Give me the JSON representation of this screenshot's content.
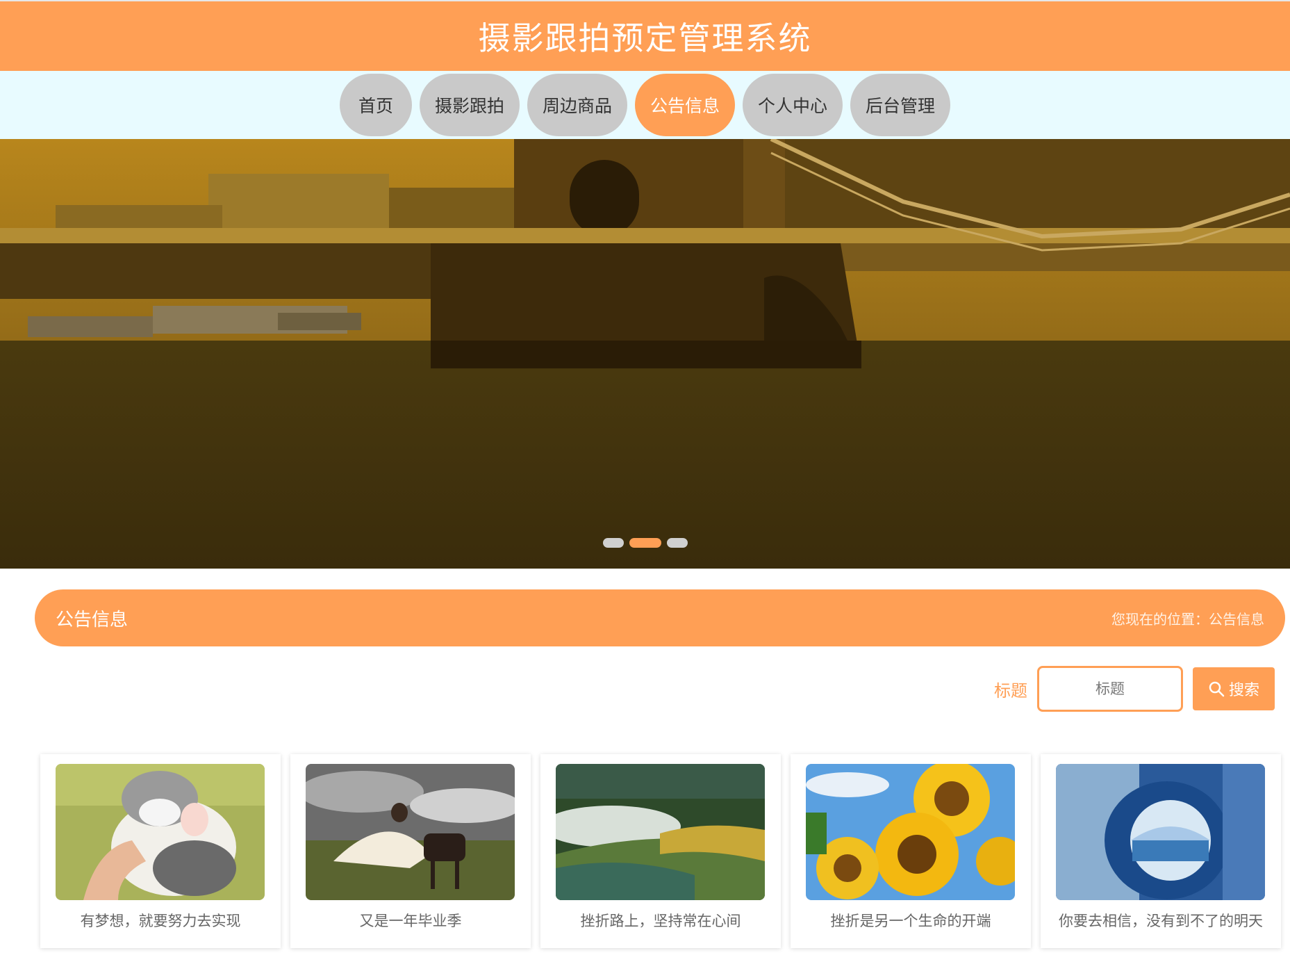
{
  "header": {
    "title": "摄影跟拍预定管理系统"
  },
  "nav": {
    "items": [
      {
        "label": "首页",
        "active": false
      },
      {
        "label": "摄影跟拍",
        "active": false
      },
      {
        "label": "周边商品",
        "active": false
      },
      {
        "label": "公告信息",
        "active": true
      },
      {
        "label": "个人中心",
        "active": false
      },
      {
        "label": "后台管理",
        "active": false
      }
    ]
  },
  "banner": {
    "image": "tower-bridge-photo",
    "slides": 3,
    "active_slide": 2
  },
  "section": {
    "title": "公告信息",
    "breadcrumb": "您现在的位置：公告信息"
  },
  "search": {
    "label": "标题",
    "placeholder": "标题",
    "button_label": "搜索",
    "button_icon": "search-icon"
  },
  "cards": [
    {
      "caption": "有梦想，就要努力去实现",
      "image": "cat-photo"
    },
    {
      "caption": "又是一年毕业季",
      "image": "bride-horse-photo"
    },
    {
      "caption": "挫折路上，坚持常在心间",
      "image": "rice-terraces-photo"
    },
    {
      "caption": "挫折是另一个生命的开端",
      "image": "sunflowers-photo"
    },
    {
      "caption": "你要去相信，没有到不了的明天",
      "image": "ice-tunnel-photo"
    }
  ],
  "colors": {
    "accent": "#ff9f55",
    "nav_bg": "#e8fbff",
    "nav_inactive": "#c9c9c9"
  }
}
